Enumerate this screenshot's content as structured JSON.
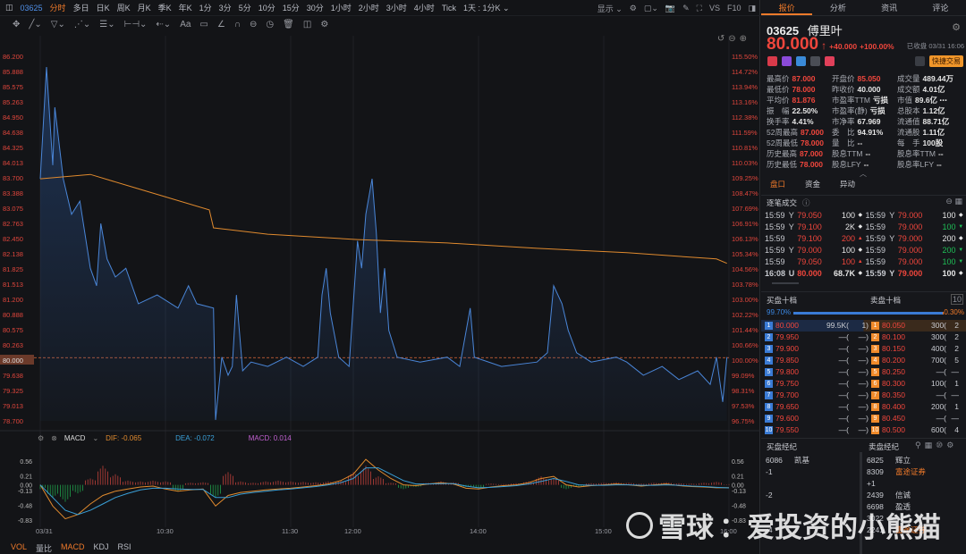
{
  "topbar": {
    "code": "03625",
    "periods": [
      "分时",
      "多日",
      "日K",
      "周K",
      "月K",
      "季K",
      "年K",
      "1分",
      "3分",
      "5分",
      "10分",
      "15分",
      "30分",
      "1小时",
      "2小时",
      "3小时",
      "4小时",
      "Tick",
      "1天 : 1分K ⌄"
    ],
    "active": "分时",
    "display": "显示 ⌄",
    "vs": "VS",
    "f10": "F10"
  },
  "toolbar": {
    "icons": [
      "move-icon",
      "line-icon",
      "channel-icon",
      "pattern-icon",
      "fib-icon",
      "measure-icon",
      "arrow-icon",
      "text-icon",
      "note-icon",
      "angle-icon",
      "magnet-icon",
      "lock-icon",
      "clock-icon",
      "trash-icon",
      "eye-icon",
      "settings-icon"
    ],
    "glyphs": [
      "✥",
      "╱⌄",
      "▽⌄",
      "⋰⌄",
      "☰⌄",
      "⊢⊣⌄",
      "⇠⌄",
      "Aa",
      "▭",
      "∠",
      "∩",
      "⊖",
      "◷",
      "🗑",
      "◫",
      "⚙"
    ]
  },
  "chart_data": {
    "type": "line",
    "title": "03625 分时",
    "x_unit": "trading minute from 09:30",
    "x_ticks": [
      {
        "m": 0,
        "label": "03/31"
      },
      {
        "m": 60,
        "label": "10:30"
      },
      {
        "m": 120,
        "label": "11:30"
      },
      {
        "m": 150,
        "label": "12:00"
      },
      {
        "m": 210,
        "label": "14:00"
      },
      {
        "m": 270,
        "label": "15:00"
      },
      {
        "m": 330,
        "label": "16:00"
      }
    ],
    "price_ticks": [
      "86.200",
      "85.888",
      "85.575",
      "85.263",
      "84.950",
      "84.638",
      "84.325",
      "84.013",
      "83.700",
      "83.388",
      "83.075",
      "82.763",
      "82.450",
      "82.138",
      "81.825",
      "81.513",
      "81.200",
      "80.888",
      "80.575",
      "80.263",
      "80.000",
      "79.638",
      "79.325",
      "79.013",
      "78.700"
    ],
    "pct_ticks": [
      "115.50%",
      "114.72%",
      "113.94%",
      "113.16%",
      "112.38%",
      "111.59%",
      "110.81%",
      "110.03%",
      "109.25%",
      "108.47%",
      "107.69%",
      "106.91%",
      "106.13%",
      "105.34%",
      "104.56%",
      "103.78%",
      "103.00%",
      "102.22%",
      "101.44%",
      "100.66%",
      "100.00%",
      "99.09%",
      "98.31%",
      "97.53%",
      "96.75%"
    ],
    "ylim": [
      78.7,
      86.2
    ],
    "ref_price": 80.0,
    "series": [
      {
        "name": "price",
        "color": "#4a86d8",
        "x": [
          0,
          3,
          6,
          7,
          11,
          15,
          19,
          24,
          27,
          29,
          32,
          36,
          41,
          47,
          56,
          66,
          71,
          75,
          83,
          84,
          87,
          90,
          92,
          94,
          97,
          101,
          109,
          118,
          126,
          133,
          135,
          137,
          139,
          143,
          148,
          152,
          154,
          156,
          159,
          161,
          163,
          165,
          167,
          171,
          182,
          195,
          201,
          206,
          208,
          221,
          238,
          243,
          246,
          250,
          253,
          257,
          264,
          276,
          281,
          289,
          298,
          306,
          315,
          321,
          324,
          327,
          329
        ],
        "y": [
          83.68,
          85.98,
          83.96,
          85.15,
          83.68,
          82.95,
          83.22,
          81.84,
          81.48,
          82.76,
          82.03,
          81.66,
          81.84,
          81.11,
          81.29,
          81.02,
          81.48,
          81.11,
          81.02,
          78.72,
          80.01,
          79.64,
          79.82,
          81.29,
          79.73,
          79.91,
          79.82,
          80.01,
          79.82,
          80.01,
          81.29,
          81.84,
          80.92,
          80.01,
          79.82,
          82.4,
          81.84,
          82.95,
          83.68,
          82.58,
          80.92,
          81.84,
          80.56,
          80.01,
          79.91,
          80.01,
          79.82,
          81.02,
          80.01,
          79.82,
          79.91,
          80.1,
          81.48,
          81.11,
          80.56,
          80.1,
          79.91,
          80.01,
          79.91,
          79.64,
          79.82,
          79.55,
          79.73,
          79.45,
          80.01,
          79.09,
          80.01
        ]
      },
      {
        "name": "avg",
        "color": "#e08a2e",
        "x": [
          0,
          24,
          45,
          81,
          83,
          109,
          152,
          195,
          238,
          281,
          324,
          329
        ],
        "y": [
          83.68,
          83.77,
          83.5,
          83.04,
          82.67,
          82.54,
          82.43,
          82.36,
          82.25,
          82.16,
          82.03,
          81.94
        ]
      }
    ],
    "macd": {
      "label": "MACD",
      "dif_label": "DIF: -0.065",
      "dea_label": "DEA: -0.072",
      "macd_label": "MACD: 0.014",
      "ticks": [
        "0.56",
        "0.21",
        "0.00",
        "-0.13",
        "-0.48",
        "-0.83"
      ],
      "tick_values": [
        0.56,
        0.21,
        0,
        -0.13,
        -0.48,
        -0.83
      ],
      "ylim": [
        -0.9,
        0.62
      ],
      "step_minutes": 6,
      "hist": [
        -0.1,
        -0.3,
        -0.4,
        -0.2,
        0.15,
        0.45,
        0.25,
        0.1,
        0.08,
        0.1,
        0.08,
        -0.15,
        0.05,
        0.06,
        -0.3,
        0.3,
        0.08,
        0.05,
        0.08,
        0.1,
        0.08,
        0.07,
        0.06,
        0.08,
        0.1,
        0.3,
        0.45,
        0.2,
        0.05,
        -0.1,
        -0.05,
        0.05,
        0.08,
        0.06,
        -0.05,
        -0.08,
        0.03,
        0.02,
        0.04,
        0.08,
        0.2,
        0.15,
        -0.1,
        -0.05,
        0.04,
        0.05,
        0.06,
        0.05,
        0.03,
        0.05,
        0.06,
        0.04,
        0.03,
        0.05,
        0.07,
        0.014
      ],
      "dif": [
        0,
        -0.5,
        -0.8,
        -0.7,
        -0.45,
        -0.25,
        -0.15,
        -0.1,
        -0.05,
        -0.03,
        -0.1,
        -0.15,
        -0.12,
        -0.1,
        -0.5,
        -0.25,
        -0.18,
        -0.15,
        -0.12,
        -0.1,
        -0.08,
        -0.05,
        -0.02,
        0.02,
        0.1,
        0.25,
        0.6,
        0.35,
        0.15,
        0.0,
        -0.02,
        0.02,
        0.05,
        0.02,
        -0.08,
        -0.1,
        -0.05,
        -0.02,
        0.0,
        0.05,
        0.15,
        0.2,
        0.0,
        -0.05,
        -0.02,
        0.0,
        0.02,
        0.0,
        -0.03,
        0.0,
        0.02,
        -0.02,
        -0.04,
        -0.05,
        -0.07,
        -0.065
      ],
      "dea": [
        0,
        -0.3,
        -0.6,
        -0.7,
        -0.6,
        -0.45,
        -0.3,
        -0.2,
        -0.12,
        -0.08,
        -0.08,
        -0.1,
        -0.11,
        -0.11,
        -0.3,
        -0.3,
        -0.22,
        -0.18,
        -0.15,
        -0.12,
        -0.1,
        -0.07,
        -0.04,
        0.0,
        0.05,
        0.15,
        0.4,
        0.4,
        0.25,
        0.1,
        0.02,
        0.02,
        0.03,
        0.03,
        -0.03,
        -0.07,
        -0.06,
        -0.04,
        -0.02,
        0.02,
        0.08,
        0.15,
        0.08,
        0.0,
        -0.01,
        -0.01,
        0.0,
        0.0,
        -0.01,
        -0.01,
        0.0,
        -0.01,
        -0.03,
        -0.04,
        -0.06,
        -0.072
      ]
    }
  },
  "bottom_tabs": [
    "VOL",
    "量比",
    "MACD",
    "KDJ",
    "RSI"
  ],
  "right": {
    "tabs": [
      "报价",
      "分析",
      "资讯",
      "评论"
    ],
    "code": "03625",
    "name": "傅里叶",
    "price": "80.000",
    "arrow": "↑",
    "change": "+40.000",
    "change_pct": "+100.00%",
    "status": "已收盘 03/31 16:06",
    "quick_trade": "快捷交易",
    "stats": [
      [
        [
          "最高价",
          "87.000",
          "red"
        ],
        [
          "开盘价",
          "85.050",
          "red"
        ],
        [
          "成交量",
          "489.44万",
          "wht"
        ]
      ],
      [
        [
          "最低价",
          "78.000",
          "red"
        ],
        [
          "昨收价",
          "40.000",
          "wht"
        ],
        [
          "成交额",
          "4.01亿",
          "wht"
        ]
      ],
      [
        [
          "平均价",
          "81.876",
          "red"
        ],
        [
          "市盈率TTM",
          "亏损",
          "wht"
        ],
        [
          "市值",
          "89.6亿 ⋯",
          "wht"
        ]
      ],
      [
        [
          "振　幅",
          "22.50%",
          "wht"
        ],
        [
          "市盈率(静)",
          "亏损",
          "wht"
        ],
        [
          "总股本",
          "1.12亿",
          "wht"
        ]
      ],
      [
        [
          "换手率",
          "4.41%",
          "wht"
        ],
        [
          "市净率",
          "67.969",
          "wht"
        ],
        [
          "流通值",
          "88.71亿",
          "wht"
        ]
      ],
      [
        [
          "52周最高",
          "87.000",
          "red"
        ],
        [
          "委　比",
          "94.91%",
          "wht"
        ],
        [
          "流通股",
          "1.11亿",
          "wht"
        ]
      ],
      [
        [
          "52周最低",
          "78.000",
          "red"
        ],
        [
          "量　比",
          "--",
          "wht"
        ],
        [
          "每　手",
          "100股",
          "wht"
        ]
      ],
      [
        [
          "历史最高",
          "87.000",
          "red"
        ],
        [
          "股息TTM",
          "--",
          "wht"
        ],
        [
          "股息率TTM",
          "--",
          "wht"
        ]
      ],
      [
        [
          "历史最低",
          "78.000",
          "red"
        ],
        [
          "股息LFY",
          "--",
          "wht"
        ],
        [
          "股息率LFY",
          "--",
          "wht"
        ]
      ]
    ],
    "subtabs": [
      "盘口",
      "资金",
      "异动"
    ],
    "trades_title": "逐笔成交",
    "trades": [
      [
        [
          "15:59",
          "Y",
          "79.050",
          "100",
          "◆",
          "wht",
          "wht"
        ],
        [
          "15:59",
          "Y",
          "79.000",
          "100",
          "◆",
          "wht",
          "wht"
        ]
      ],
      [
        [
          "15:59",
          "Y",
          "79.100",
          "2K",
          "◆",
          "wht",
          "wht"
        ],
        [
          "15:59",
          "",
          "79.000",
          "100",
          "▼",
          "grn",
          "grn"
        ]
      ],
      [
        [
          "15:59",
          "",
          "79.100",
          "200",
          "▲",
          "red",
          "red"
        ],
        [
          "15:59",
          "Y",
          "79.000",
          "200",
          "◆",
          "wht",
          "wht"
        ]
      ],
      [
        [
          "15:59",
          "Y",
          "79.000",
          "100",
          "◆",
          "wht",
          "wht"
        ],
        [
          "15:59",
          "",
          "79.000",
          "200",
          "▼",
          "grn",
          "grn"
        ]
      ],
      [
        [
          "15:59",
          "",
          "79.050",
          "100",
          "▲",
          "red",
          "red"
        ],
        [
          "15:59",
          "",
          "79.000",
          "100",
          "▼",
          "grn",
          "grn"
        ]
      ],
      [
        [
          "16:08",
          "U",
          "80.000",
          "68.7K",
          "◆",
          "wht",
          "wht"
        ],
        [
          "15:59",
          "Y",
          "79.000",
          "100",
          "◆",
          "wht",
          "wht"
        ]
      ]
    ],
    "bid_title": "买盘十档",
    "ask_title": "卖盘十档",
    "bid_pct": "99.70%",
    "ask_pct": "0.30%",
    "bid_ratio": 0.997,
    "book": [
      [
        "1",
        "80.000",
        "99.5K(",
        "1)",
        "80.050",
        "300(",
        "2"
      ],
      [
        "2",
        "79.950",
        "—(",
        "—)",
        "80.100",
        "300(",
        "2"
      ],
      [
        "3",
        "79.900",
        "—(",
        "—)",
        "80.150",
        "400(",
        "2"
      ],
      [
        "4",
        "79.850",
        "—(",
        "—)",
        "80.200",
        "700(",
        "5"
      ],
      [
        "5",
        "79.800",
        "—(",
        "—)",
        "80.250",
        "—(",
        "—"
      ],
      [
        "6",
        "79.750",
        "—(",
        "—)",
        "80.300",
        "100(",
        "1"
      ],
      [
        "7",
        "79.700",
        "—(",
        "—)",
        "80.350",
        "—(",
        "—"
      ],
      [
        "8",
        "79.650",
        "—(",
        "—)",
        "80.400",
        "200(",
        "1"
      ],
      [
        "9",
        "79.600",
        "—(",
        "—)",
        "80.450",
        "—(",
        "—"
      ],
      [
        "10",
        "79.550",
        "—(",
        "—)",
        "80.500",
        "600(",
        "4"
      ]
    ],
    "bid_broker_title": "买盘经纪",
    "ask_broker_title": "卖盘经纪",
    "bid_brokers": [
      [
        "6086",
        "凯基",
        ""
      ],
      [
        "-1",
        "",
        ""
      ],
      [
        "",
        "",
        ""
      ],
      [
        "-2",
        "",
        ""
      ],
      [
        "",
        "",
        ""
      ],
      [
        "",
        "",
        ""
      ],
      [
        "-4",
        "",
        ""
      ]
    ],
    "ask_brokers": [
      [
        "6825",
        "辉立",
        ""
      ],
      [
        "8309",
        "富途证券",
        "org"
      ],
      [
        "+1",
        "",
        ""
      ],
      [
        "2439",
        "信诚",
        ""
      ],
      [
        "6698",
        "盈透",
        ""
      ],
      [
        "3022",
        "",
        ""
      ],
      [
        "2241",
        "富途证券",
        "org"
      ]
    ]
  },
  "watermark": {
    "brand": "雪球",
    "text": "：爱投资的小熊猫"
  },
  "colors": {
    "up": "#f0463c",
    "down": "#1fbf56",
    "accent": "#f07a2a",
    "price_line": "#4a86d8",
    "avg_line": "#e08a2e"
  }
}
